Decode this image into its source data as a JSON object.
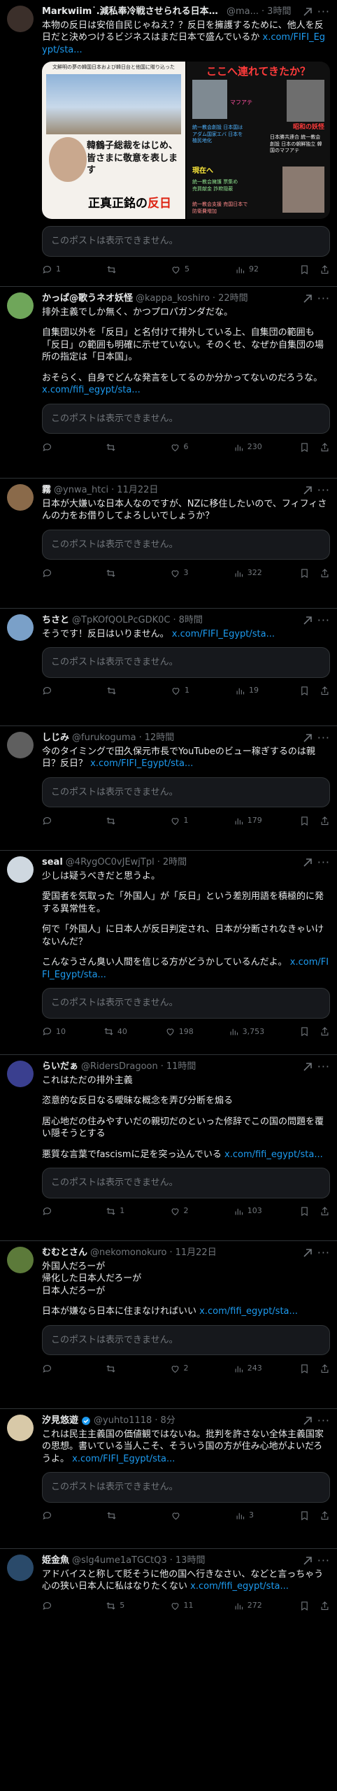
{
  "quote_unavailable": "このポストは表示できません。",
  "posts": [
    {
      "name": "Markwiim˙.減私奉冷戦させられる日本人...",
      "handle": "@ma...",
      "time": "3時間",
      "text": [
        "本物の反日は安倍自民じゃねえ？？反日を擁護するために、他人を反日だと決めつけるビジネスはまだ日本で盛んでいるか"
      ],
      "link": "x.com/FIFI_Egypt/sta...",
      "media": {
        "left_caption": "文鮮明の夢の韓国日本および韓日台と他国に贈り込った",
        "left_banner": "韓鶴子総裁をはじめ、皆さまに敬意を表します",
        "left_slogan_a": "正真正銘の",
        "left_slogan_b": "反日",
        "right_title": "ここへ連れてきたか？",
        "right_label_a": "マフアテ",
        "right_label_b": "昭和の妖怪",
        "right_label_c": "統一教会創設 日本国はアダム国家エバ 日本を植民地化",
        "right_label_d": "日本勝共連合 統一教会創設 日本の朝鮮独立 韓国のマフアテ",
        "right_label_e": "現在へ",
        "right_label_f": "統一教会擁護 票集め売買献金 詐欺隠蔽",
        "right_label_g": "統一教会支援 売国日本で 防衛費増加"
      },
      "counts": {
        "reply": "1",
        "repost": "",
        "like": "5",
        "views": "92"
      },
      "avatar": "#3b2f2a"
    },
    {
      "name": "かっぱ@歌うネオ妖怪",
      "handle": "@kappa_koshiro",
      "time": "22時間",
      "text": [
        "排外主義でしか無く、かつプロパガンダだな。",
        "自集団以外を「反日」と名付けて排外している上、自集団の範囲も「反日」の範囲も明確に示せていない。そのくせ、なぜか自集団の場所の指定は「日本国」。",
        "おそらく、自身でどんな発言をしてるのか分かってないのだろうな。"
      ],
      "link": "x.com/fifi_egypt/sta...",
      "counts": {
        "reply": "",
        "repost": "",
        "like": "6",
        "views": "230"
      },
      "avatar": "#6fa65a"
    },
    {
      "name": "霧",
      "handle": "@ynwa_htci",
      "time": "11月22日",
      "text": [
        "日本が大嫌いな日本人なのですが、NZに移住したいので、フィフィさんの力をお借りしてよろしいでしょうか？"
      ],
      "link": "",
      "counts": {
        "reply": "",
        "repost": "",
        "like": "3",
        "views": "322"
      },
      "avatar": "#8a6a4a"
    },
    {
      "name": "ちさと",
      "handle": "@TpKOfQOLPcGDK0C",
      "time": "8時間",
      "text": [
        "そうです！反日はいりません。"
      ],
      "link": "x.com/FIFI_Egypt/sta...",
      "counts": {
        "reply": "",
        "repost": "",
        "like": "1",
        "views": "19"
      },
      "avatar": "#7aa0c8"
    },
    {
      "name": "しじみ",
      "handle": "@furukoguma",
      "time": "12時間",
      "text": [
        "今のタイミングで田久保元市長でYouTubeのビュー稼ぎするのは親日？反日？"
      ],
      "link": "x.com/FIFI_Egypt/sta...",
      "counts": {
        "reply": "",
        "repost": "",
        "like": "1",
        "views": "179"
      },
      "avatar": "#5f5f5f"
    },
    {
      "name": "seal",
      "handle": "@4RygOC0vJEwjTpl",
      "time": "2時間",
      "text": [
        "少しは疑うべきだと思うよ。",
        "愛国者を気取った「外国人」が「反日」という差別用語を積極的に発する異常性を。",
        "何で「外国人」に日本人が反日判定され、日本が分断されなきゃいけないんだ？",
        "こんなうさん臭い人間を信じる方がどうかしているんだよ。"
      ],
      "link": "x.com/FIFI_Egypt/sta...",
      "counts": {
        "reply": "10",
        "repost": "40",
        "like": "198",
        "views": "3,753"
      },
      "avatar": "#cfd8e0"
    },
    {
      "name": "らいだぁ",
      "handle": "@RidersDragoon",
      "time": "11時間",
      "text": [
        "これはただの排外主義",
        "恣意的な反日なる曖昧な概念を弄び分断を煽る",
        "居心地だの住みやすいだの親切だのといった修辞でこの国の問題を覆い隠そうとする",
        "悪質な言葉でfascismに足を突っ込んでいる"
      ],
      "link": "x.com/fifi_egypt/sta...",
      "counts": {
        "reply": "",
        "repost": "1",
        "like": "2",
        "views": "103"
      },
      "avatar": "#3a3f8f"
    },
    {
      "name": "むむとさん",
      "handle": "@nekomonokuro",
      "time": "11月22日",
      "text": [
        "外国人だろーが\n帰化した日本人だろーが\n日本人だろーが",
        "日本が嫌なら日本に住まなければいい"
      ],
      "link": "x.com/fifi_egypt/sta...",
      "counts": {
        "reply": "",
        "repost": "",
        "like": "2",
        "views": "243"
      },
      "avatar": "#5c7a3a"
    },
    {
      "name": "汐見悠遊",
      "handle": "@yuhto1118",
      "time": "8分",
      "text": [
        "これは民主主義国の価値観ではないね。批判を許さない全体主義国家の思想。書いている当人こそ、そういう国の方が住み心地がよいだろうよ。"
      ],
      "link": "x.com/FIFI_Egypt/sta...",
      "counts": {
        "reply": "",
        "repost": "",
        "like": "",
        "views": "3"
      },
      "avatar": "#d8c9a8"
    },
    {
      "name": "姫金魚",
      "handle": "@slg4ume1aTGCtQ3",
      "time": "13時間",
      "text": [
        "アドバイスと称して貶そうに他の国へ行きなさい、などと言っちゃう心の狭い日本人に私はなりたくない"
      ],
      "link": "x.com/fifi_egypt/sta...",
      "counts": {
        "reply": "",
        "repost": "5",
        "like": "11",
        "views": "272"
      },
      "avatar": "#2a4a6a"
    }
  ]
}
